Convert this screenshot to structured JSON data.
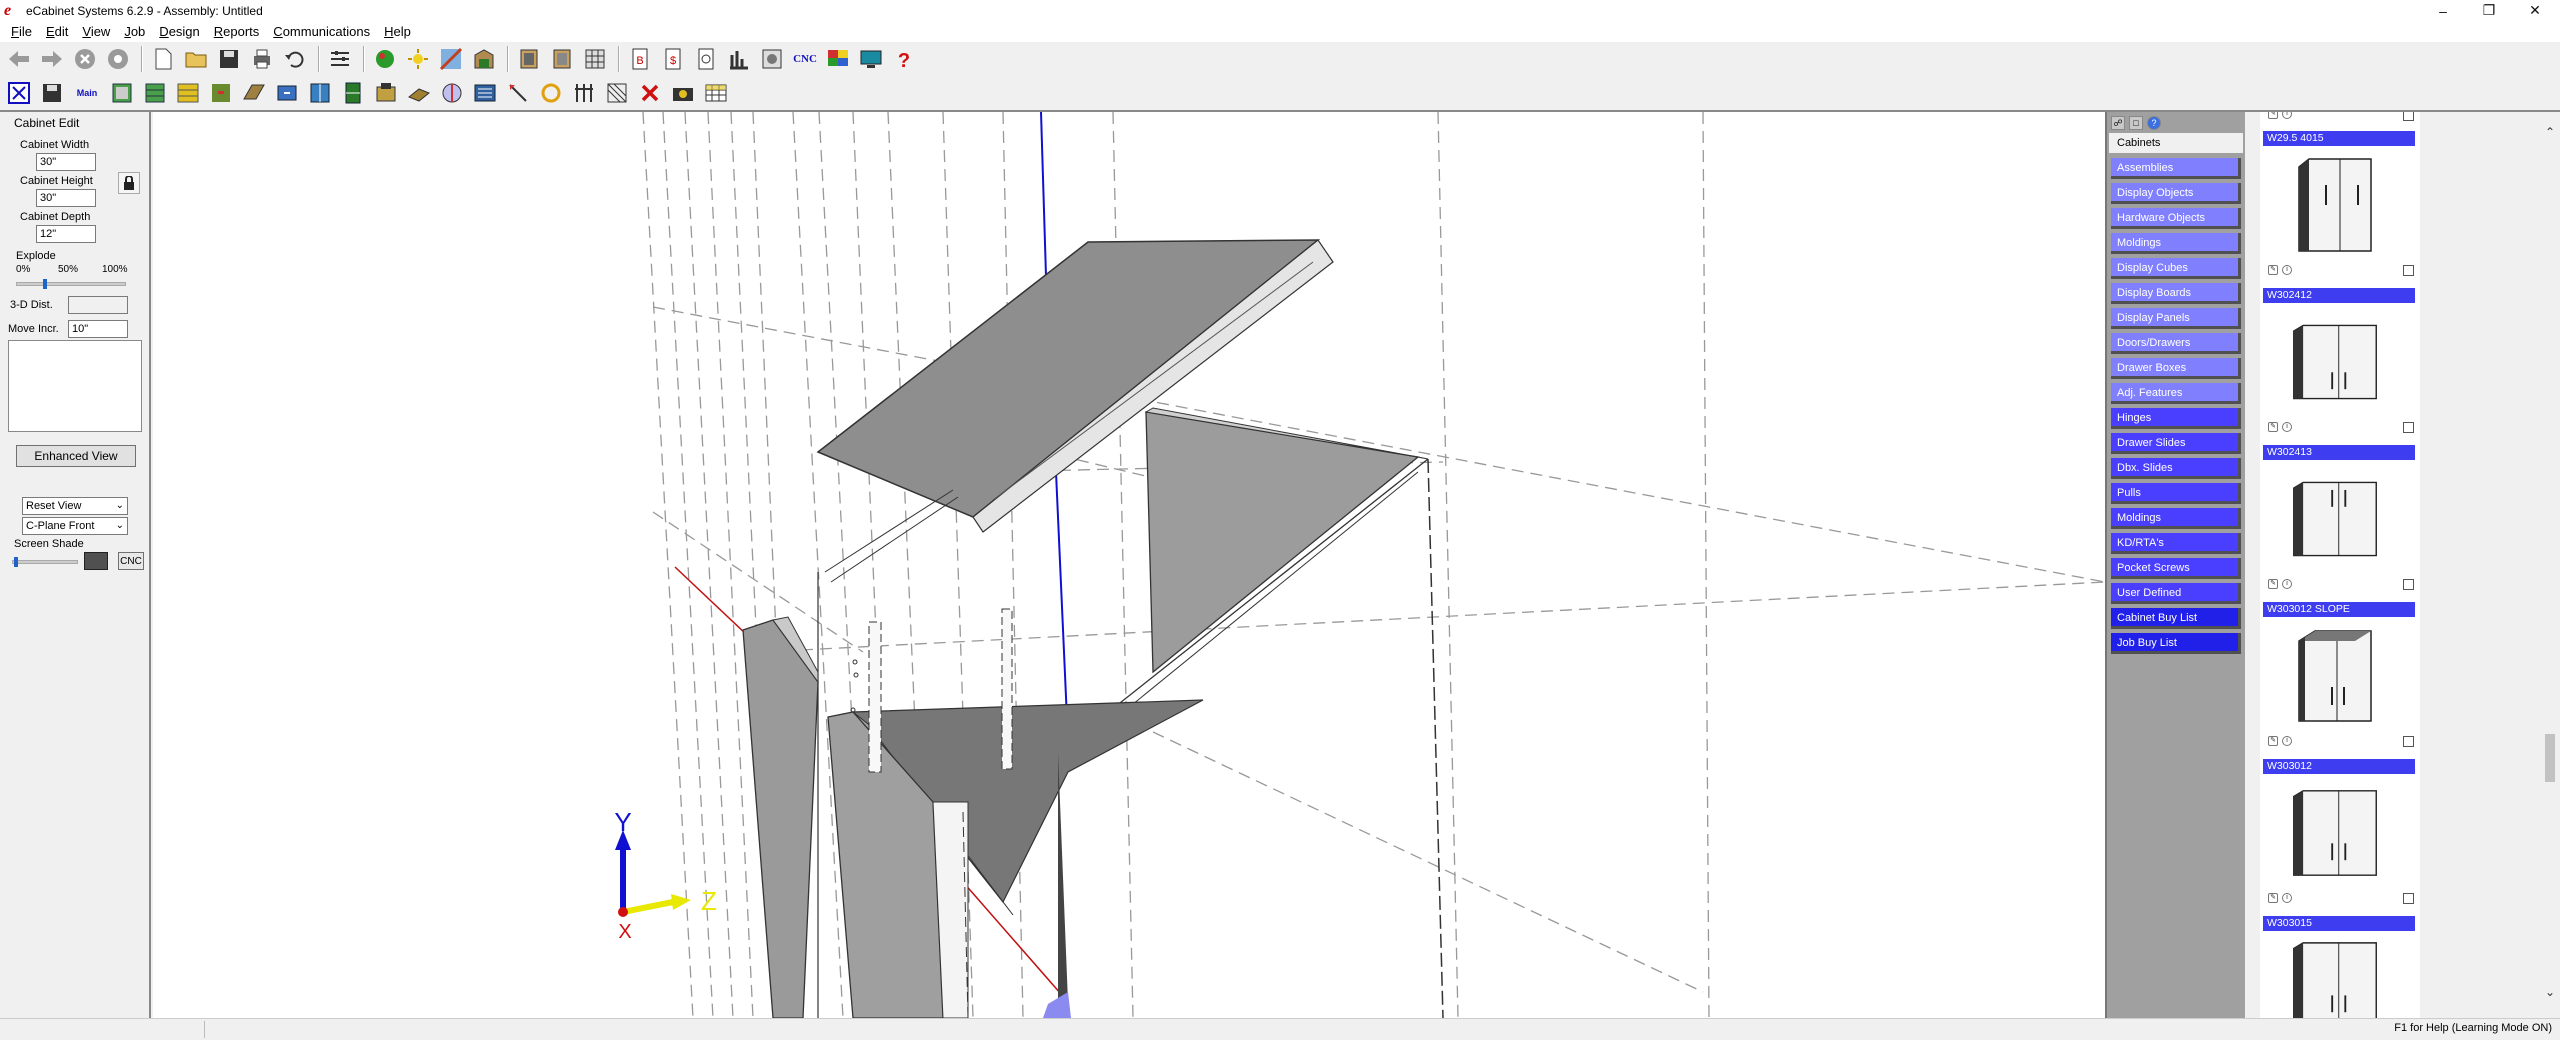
{
  "window": {
    "title": "eCabinet Systems 6.2.9 - Assembly: Untitled",
    "logo": "e",
    "controls": [
      "minimize",
      "restore",
      "close"
    ]
  },
  "menu": [
    "File",
    "Edit",
    "View",
    "Job",
    "Design",
    "Reports",
    "Communications",
    "Help"
  ],
  "toolbar1": {
    "buttons": [
      "back-arrow-icon",
      "forward-arrow-icon",
      "stop-icon",
      "circle-icon",
      "new-file-icon",
      "open-folder-icon",
      "save-disk-icon",
      "print-icon",
      "undo-icon",
      "settings-sliders-icon",
      "materials-icon",
      "lighting-icon",
      "edge-icon",
      "cabinet-icon",
      "cabinet-box-icon",
      "cabinet-door-icon",
      "grid-icon",
      "b-report-icon",
      "dollar-report-icon",
      "report-icon",
      "chart-icon",
      "config-icon",
      "cnc-icon",
      "multicolor-icon",
      "monitor-icon",
      "help-question-icon"
    ],
    "cnc_label": "CNC"
  },
  "toolbar2": {
    "main_label": "Main",
    "buttons": [
      "close-x-icon",
      "save-icon",
      "main-icon",
      "cabinet-green-icon",
      "cabinet-drawers-icon",
      "shelf-icon",
      "cabinet-pull-icon",
      "floor-icon",
      "drawer-icon",
      "cabinet-wall-icon",
      "cabinet-tall-icon",
      "bench-icon",
      "material-icon",
      "measure-icon",
      "rotate-icon",
      "layout-icon",
      "dimension-icon",
      "hatch-icon",
      "delete-icon",
      "camera-icon",
      "table-icon"
    ]
  },
  "left_panel": {
    "heading": "Cabinet Edit",
    "width_label": "Cabinet Width",
    "width_value": "30\"",
    "height_label": "Cabinet Height",
    "height_value": "30\"",
    "depth_label": "Cabinet Depth",
    "depth_value": "12\"",
    "explode_label": "Explode",
    "explode_ticks": [
      "0%",
      "50%",
      "100%"
    ],
    "explode_level": 0.25,
    "dist_label": "3-D Dist.",
    "dist_value": "",
    "move_label": "Move Incr.",
    "move_value": "10\"",
    "enhanced_view": "Enhanced View",
    "reset_view": "Reset View",
    "plane": "C-Plane Front",
    "screen_shade": "Screen Shade",
    "screen_shade_level": 0.02,
    "cnc": "CNC"
  },
  "viewport": {
    "axis_y": "Y",
    "axis_z": "Z",
    "axis_x": "X",
    "colors": {
      "y_axis": "#1010d0",
      "z_axis": "#e8e800",
      "x_axis": "#d01010",
      "panel_dark": "#8a8a8a",
      "panel_mid": "#a0a0a0"
    }
  },
  "categories": {
    "header": "Cabinets",
    "items": [
      "Assemblies",
      "Display Objects",
      "Hardware Objects",
      "Moldings",
      "Display Cubes",
      "Display Boards",
      "Display Panels",
      "Doors/Drawers",
      "Drawer Boxes",
      "Adj. Features",
      "Hinges",
      "Drawer Slides",
      "Dbx. Slides",
      "Pulls",
      "Moldings",
      "KD/RTA's",
      "Pocket Screws",
      "User Defined",
      "Cabinet Buy List",
      "Job Buy List"
    ]
  },
  "thumbnails": [
    "W29.5 4015",
    "W302412",
    "W302413",
    "W303012 SLOPE",
    "W303012",
    "W303015"
  ],
  "status": {
    "help_text": "F1 for Help (Learning Mode ON)"
  }
}
